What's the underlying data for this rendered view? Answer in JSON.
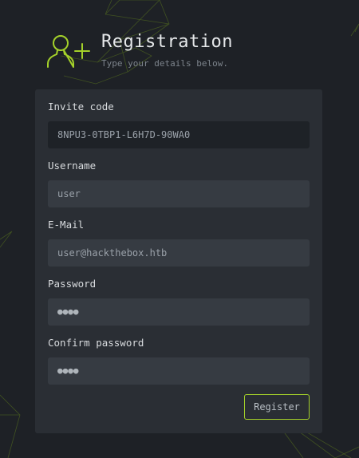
{
  "header": {
    "title": "Registration",
    "subtitle": "Type your details below.",
    "icon": "user-add-icon"
  },
  "form": {
    "fields": [
      {
        "label": "Invite code",
        "value": "8NPU3-0TBP1-L6H7D-90WA0",
        "readonly": true
      },
      {
        "label": "Username",
        "value": "user"
      },
      {
        "label": "E-Mail",
        "value": "user@hackthebox.htb"
      },
      {
        "label": "Password",
        "value": "●●●●"
      },
      {
        "label": "Confirm password",
        "value": "●●●●"
      }
    ],
    "submit_label": "Register"
  },
  "colors": {
    "accent": "#9fef00",
    "background": "#1e2126",
    "panel": "#2a2e34",
    "input": "#363b42"
  }
}
